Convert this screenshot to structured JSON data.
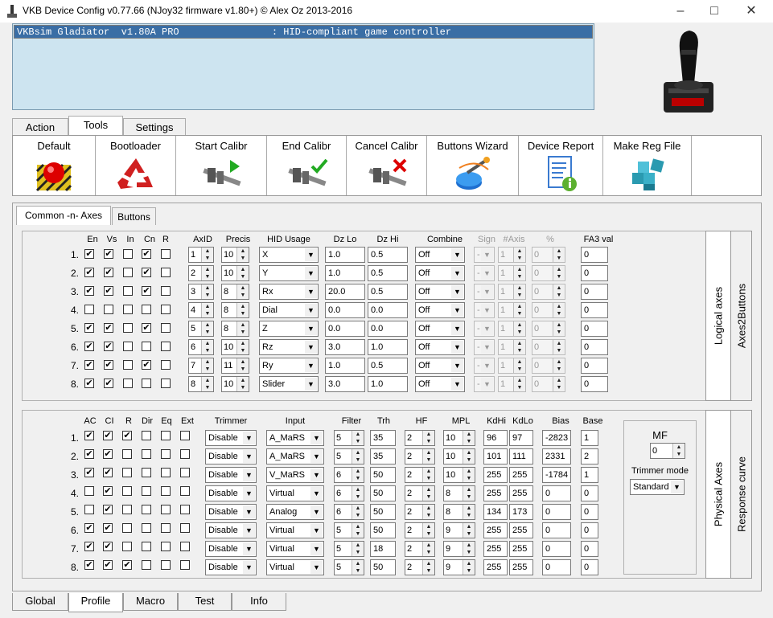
{
  "window": {
    "title": "VKB Device Config v0.77.66 (NJoy32 firmware v1.80+) © Alex Oz 2013-2016"
  },
  "device_list": {
    "selected": "VKBsim Gladiator  v1.80A PRO                : HID-compliant game controller"
  },
  "top_tabs": [
    "Action",
    "Tools",
    "Settings"
  ],
  "toolbar": [
    {
      "label": "Default",
      "icon": "red-button-icon"
    },
    {
      "label": "Bootloader",
      "icon": "recycle-icon"
    },
    {
      "label": "Start Calibr",
      "icon": "caliper-play-icon"
    },
    {
      "label": "End Calibr",
      "icon": "caliper-check-icon"
    },
    {
      "label": "Cancel Calibr",
      "icon": "caliper-cancel-icon"
    },
    {
      "label": "Buttons Wizard",
      "icon": "wizard-button-icon"
    },
    {
      "label": "Device Report",
      "icon": "report-info-icon"
    },
    {
      "label": "Make Reg File",
      "icon": "registry-cubes-icon"
    }
  ],
  "sub_tabs": [
    "Common -n- Axes",
    "Buttons"
  ],
  "logical": {
    "headers": {
      "en": "En",
      "vs": "Vs",
      "in": "In",
      "cn": "Cn",
      "r": "R",
      "axid": "AxID",
      "precis": "Precis",
      "hid": "HID Usage",
      "dzlo": "Dz Lo",
      "dzhi": "Dz Hi",
      "combine": "Combine",
      "sign": "Sign",
      "naxis": "#Axis",
      "pct": "%",
      "fa3": "FA3 val"
    },
    "rows": [
      {
        "n": "1.",
        "en": true,
        "vs": true,
        "in": false,
        "cn": true,
        "r": false,
        "axid": "1",
        "precis": "10",
        "hid": "X",
        "dzlo": "1.0",
        "dzhi": "0.5",
        "combine": "Off",
        "sign": "-",
        "naxis": "1",
        "pct": "0",
        "fa3": "0"
      },
      {
        "n": "2.",
        "en": true,
        "vs": true,
        "in": false,
        "cn": true,
        "r": false,
        "axid": "2",
        "precis": "10",
        "hid": "Y",
        "dzlo": "1.0",
        "dzhi": "0.5",
        "combine": "Off",
        "sign": "-",
        "naxis": "1",
        "pct": "0",
        "fa3": "0"
      },
      {
        "n": "3.",
        "en": true,
        "vs": true,
        "in": false,
        "cn": true,
        "r": false,
        "axid": "3",
        "precis": "8",
        "hid": "Rx",
        "dzlo": "20.0",
        "dzhi": "0.5",
        "combine": "Off",
        "sign": "-",
        "naxis": "1",
        "pct": "0",
        "fa3": "0"
      },
      {
        "n": "4.",
        "en": false,
        "vs": false,
        "in": false,
        "cn": false,
        "r": false,
        "axid": "4",
        "precis": "8",
        "hid": "Dial",
        "dzlo": "0.0",
        "dzhi": "0.0",
        "combine": "Off",
        "sign": "-",
        "naxis": "1",
        "pct": "0",
        "fa3": "0"
      },
      {
        "n": "5.",
        "en": true,
        "vs": true,
        "in": false,
        "cn": true,
        "r": false,
        "axid": "5",
        "precis": "8",
        "hid": "Z",
        "dzlo": "0.0",
        "dzhi": "0.0",
        "combine": "Off",
        "sign": "-",
        "naxis": "1",
        "pct": "0",
        "fa3": "0"
      },
      {
        "n": "6.",
        "en": true,
        "vs": true,
        "in": false,
        "cn": false,
        "r": false,
        "axid": "6",
        "precis": "10",
        "hid": "Rz",
        "dzlo": "3.0",
        "dzhi": "1.0",
        "combine": "Off",
        "sign": "-",
        "naxis": "1",
        "pct": "0",
        "fa3": "0"
      },
      {
        "n": "7.",
        "en": true,
        "vs": true,
        "in": false,
        "cn": true,
        "r": false,
        "axid": "7",
        "precis": "11",
        "hid": "Ry",
        "dzlo": "1.0",
        "dzhi": "0.5",
        "combine": "Off",
        "sign": "-",
        "naxis": "1",
        "pct": "0",
        "fa3": "0"
      },
      {
        "n": "8.",
        "en": true,
        "vs": true,
        "in": false,
        "cn": false,
        "r": false,
        "axid": "8",
        "precis": "10",
        "hid": "Slider",
        "dzlo": "3.0",
        "dzhi": "1.0",
        "combine": "Off",
        "sign": "-",
        "naxis": "1",
        "pct": "0",
        "fa3": "0"
      }
    ]
  },
  "logical_vtabs": [
    "Logical axes",
    "Axes2Buttons"
  ],
  "physical": {
    "headers": {
      "ac": "AC",
      "ci": "CI",
      "r": "R",
      "dir": "Dir",
      "eq": "Eq",
      "ext": "Ext",
      "trimmer": "Trimmer",
      "input": "Input",
      "filter": "Filter",
      "trh": "Trh",
      "hf": "HF",
      "mpl": "MPL",
      "kdhi": "KdHi",
      "kdlo": "KdLo",
      "bias": "Bias",
      "base": "Base"
    },
    "rows": [
      {
        "n": "1.",
        "ac": true,
        "ci": true,
        "r": true,
        "dir": false,
        "eq": false,
        "ext": false,
        "trimmer": "Disable",
        "input": "A_MaRS",
        "filter": "5",
        "trh": "35",
        "hf": "2",
        "mpl": "10",
        "kdhi": "96",
        "kdlo": "97",
        "bias": "-2823",
        "base": "1"
      },
      {
        "n": "2.",
        "ac": true,
        "ci": true,
        "r": false,
        "dir": false,
        "eq": false,
        "ext": false,
        "trimmer": "Disable",
        "input": "A_MaRS",
        "filter": "5",
        "trh": "35",
        "hf": "2",
        "mpl": "10",
        "kdhi": "101",
        "kdlo": "111",
        "bias": "2331",
        "base": "2"
      },
      {
        "n": "3.",
        "ac": true,
        "ci": true,
        "r": false,
        "dir": false,
        "eq": false,
        "ext": false,
        "trimmer": "Disable",
        "input": "V_MaRS",
        "filter": "6",
        "trh": "50",
        "hf": "2",
        "mpl": "10",
        "kdhi": "255",
        "kdlo": "255",
        "bias": "-1784",
        "base": "1"
      },
      {
        "n": "4.",
        "ac": false,
        "ci": true,
        "r": false,
        "dir": false,
        "eq": false,
        "ext": false,
        "trimmer": "Disable",
        "input": "Virtual",
        "filter": "6",
        "trh": "50",
        "hf": "2",
        "mpl": "8",
        "kdhi": "255",
        "kdlo": "255",
        "bias": "0",
        "base": "0"
      },
      {
        "n": "5.",
        "ac": false,
        "ci": true,
        "r": false,
        "dir": false,
        "eq": false,
        "ext": false,
        "trimmer": "Disable",
        "input": "Analog",
        "filter": "6",
        "trh": "50",
        "hf": "2",
        "mpl": "8",
        "kdhi": "134",
        "kdlo": "173",
        "bias": "0",
        "base": "0"
      },
      {
        "n": "6.",
        "ac": true,
        "ci": true,
        "r": false,
        "dir": false,
        "eq": false,
        "ext": false,
        "trimmer": "Disable",
        "input": "Virtual",
        "filter": "5",
        "trh": "50",
        "hf": "2",
        "mpl": "9",
        "kdhi": "255",
        "kdlo": "255",
        "bias": "0",
        "base": "0"
      },
      {
        "n": "7.",
        "ac": true,
        "ci": true,
        "r": false,
        "dir": false,
        "eq": false,
        "ext": false,
        "trimmer": "Disable",
        "input": "Virtual",
        "filter": "5",
        "trh": "18",
        "hf": "2",
        "mpl": "9",
        "kdhi": "255",
        "kdlo": "255",
        "bias": "0",
        "base": "0"
      },
      {
        "n": "8.",
        "ac": true,
        "ci": true,
        "r": true,
        "dir": false,
        "eq": false,
        "ext": false,
        "trimmer": "Disable",
        "input": "Virtual",
        "filter": "5",
        "trh": "50",
        "hf": "2",
        "mpl": "9",
        "kdhi": "255",
        "kdlo": "255",
        "bias": "0",
        "base": "0"
      }
    ]
  },
  "mf_box": {
    "label": "MF",
    "value": "0",
    "trimmer_mode_label": "Trimmer mode",
    "trimmer_mode": "Standard"
  },
  "physical_vtabs": [
    "Physical Axes",
    "Response curve"
  ],
  "bottom_tabs": [
    "Global",
    "Profile",
    "Macro",
    "Test",
    "Info"
  ],
  "colors": {
    "selection": "#3a6ea5",
    "device_list_bg": "#cde4f0"
  }
}
